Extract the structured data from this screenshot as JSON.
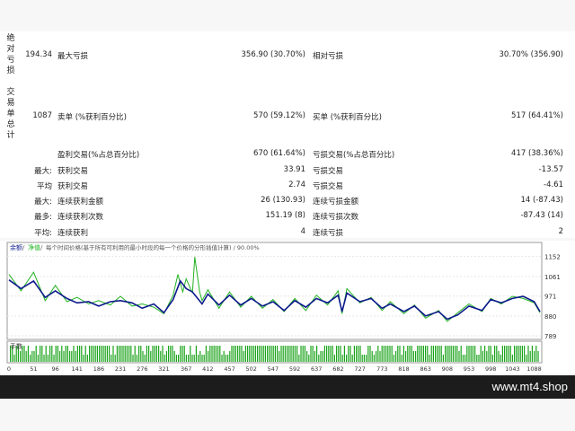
{
  "sections": {
    "absolute_drawdown": [
      "绝",
      "对",
      "亏",
      "损"
    ],
    "trade_summary": [
      "交",
      "易",
      "单",
      "总",
      "计"
    ]
  },
  "rows": [
    {
      "c1": "194.34",
      "c2": "最大亏损",
      "c3": "356.90 (30.70%)",
      "c4": "相对亏损",
      "c5": "30.70% (356.90)"
    },
    {
      "c1": "1087",
      "c2": "卖单 (%获利百分比)",
      "c3": "570 (59.12%)",
      "c4": "买单 (%获利百分比)",
      "c5": "517 (64.41%)"
    },
    {
      "c1": "",
      "c2": "盈利交易(%占总百分比)",
      "c3": "670 (61.64%)",
      "c4": "亏损交易(%占总百分比)",
      "c5": "417 (38.36%)"
    },
    {
      "c1": "最大:",
      "c2": "获利交易",
      "c3": "33.91",
      "c4": "亏损交易",
      "c5": "-13.57"
    },
    {
      "c1": "平均",
      "c2": "获利交易",
      "c3": "2.74",
      "c4": "亏损交易",
      "c5": "-4.61"
    },
    {
      "c1": "最大:",
      "c2": "连续获利金额",
      "c3": "26 (130.93)",
      "c4": "连续亏损金额",
      "c5": "14 (-87.43)"
    },
    {
      "c1": "最多:",
      "c2": "连续获利次数",
      "c3": "151.19 (8)",
      "c4": "连续亏损次数",
      "c5": "-87.43 (14)"
    },
    {
      "c1": "平均:",
      "c2": "连续获利",
      "c3": "4",
      "c4": "连续亏损",
      "c5": "2"
    }
  ],
  "chart": {
    "legend": {
      "balance": "余额",
      "equity": "净值",
      "note": "每个时间价格(基于所有可利用的最小时段的每一个价格的分形插值计算) / 90.00%"
    },
    "volume_label": "手数",
    "y_ticks": [
      "1152",
      "1061",
      "971",
      "880",
      "789"
    ],
    "x_ticks": [
      "0",
      "51",
      "96",
      "141",
      "186",
      "231",
      "276",
      "321",
      "367",
      "412",
      "457",
      "502",
      "547",
      "592",
      "637",
      "682",
      "727",
      "773",
      "818",
      "863",
      "908",
      "953",
      "998",
      "1043",
      "1088"
    ],
    "colors": {
      "balance": "#0d1a8c",
      "equity": "#22b322",
      "volume": "#1aa31a"
    }
  },
  "chart_data": {
    "type": "line",
    "ylim": [
      789,
      1200
    ],
    "xlim": [
      0,
      1100
    ],
    "series": [
      {
        "name": "余额",
        "x": [
          0,
          25,
          51,
          75,
          96,
          120,
          141,
          165,
          186,
          210,
          231,
          255,
          276,
          300,
          321,
          340,
          355,
          367,
          380,
          400,
          412,
          435,
          457,
          480,
          502,
          525,
          547,
          570,
          592,
          615,
          637,
          660,
          682,
          690,
          700,
          727,
          750,
          773,
          790,
          818,
          840,
          863,
          890,
          908,
          930,
          953,
          980,
          998,
          1020,
          1043,
          1065,
          1088,
          1100
        ],
        "y": [
          1045,
          1005,
          1040,
          965,
          995,
          960,
          940,
          945,
          925,
          945,
          950,
          940,
          915,
          935,
          895,
          955,
          1040,
          1005,
          990,
          935,
          980,
          930,
          975,
          930,
          960,
          925,
          945,
          905,
          950,
          920,
          960,
          940,
          975,
          900,
          985,
          945,
          960,
          915,
          935,
          900,
          925,
          880,
          900,
          865,
          885,
          925,
          905,
          955,
          940,
          960,
          970,
          945,
          900
        ]
      },
      {
        "name": "净值",
        "x": [
          0,
          25,
          51,
          75,
          96,
          120,
          141,
          165,
          186,
          210,
          231,
          255,
          276,
          300,
          321,
          340,
          350,
          360,
          367,
          380,
          385,
          395,
          400,
          412,
          435,
          457,
          480,
          502,
          525,
          547,
          570,
          592,
          615,
          637,
          660,
          682,
          690,
          700,
          727,
          750,
          773,
          790,
          818,
          840,
          863,
          890,
          908,
          930,
          953,
          980,
          998,
          1020,
          1043,
          1065,
          1088,
          1100
        ],
        "y": [
          1070,
          995,
          1080,
          950,
          1020,
          945,
          965,
          935,
          950,
          930,
          970,
          925,
          935,
          920,
          890,
          975,
          1070,
          990,
          1050,
          985,
          1150,
          990,
          950,
          1000,
          915,
          990,
          920,
          970,
          915,
          955,
          900,
          960,
          905,
          975,
          930,
          995,
          890,
          1005,
          940,
          965,
          905,
          945,
          890,
          930,
          870,
          905,
          855,
          895,
          935,
          900,
          960,
          935,
          970,
          960,
          940,
          895
        ]
      }
    ]
  }
}
